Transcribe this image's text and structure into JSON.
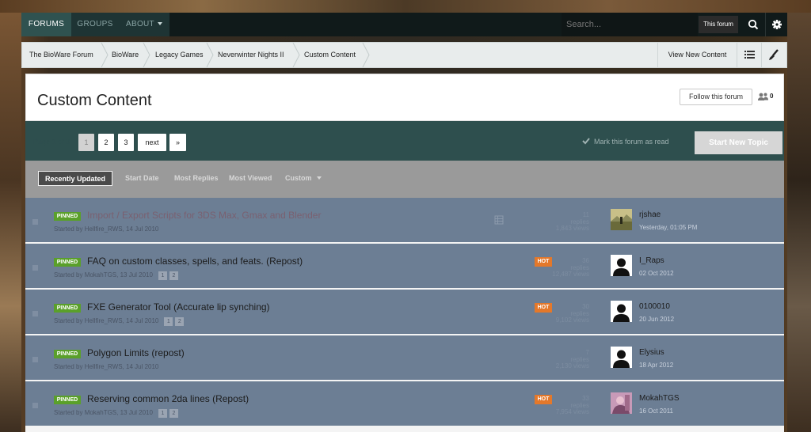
{
  "nav": {
    "tabs": [
      {
        "label": "FORUMS",
        "active": true
      },
      {
        "label": "GROUPS",
        "active": false
      },
      {
        "label": "ABOUT",
        "active": false
      }
    ],
    "search_placeholder": "Search...",
    "search_scope": "This forum",
    "icons": [
      "search-icon",
      "gear-icon"
    ]
  },
  "breadcrumb": {
    "items": [
      "The BioWare Forum",
      "BioWare",
      "Legacy Games",
      "Neverwinter Nights II",
      "Custom Content"
    ],
    "view_new": "View New Content",
    "icons": [
      "list-icon",
      "brush-icon"
    ]
  },
  "forum": {
    "title": "Custom Content",
    "follow_label": "Follow this forum",
    "follower_count": "0"
  },
  "pagination": {
    "label": "Page 1 of 3",
    "pages": [
      "1",
      "2",
      "3"
    ],
    "current": "1",
    "next_label": "next",
    "last_label": "»"
  },
  "actions": {
    "mark_read": "Mark this forum as read",
    "start_topic": "Start New Topic"
  },
  "sort": {
    "options": [
      "Recently Updated",
      "Start Date",
      "Most Replies",
      "Most Viewed",
      "Custom"
    ],
    "active": "Recently Updated"
  },
  "topics": [
    {
      "pinned": "PINNED",
      "title": "Import / Export Scripts for 3DS Max, Gmax and Blender",
      "meta": "Started by Hellfire_RWS, 14 Jul 2010",
      "pages": [],
      "hot": "",
      "stat1": "11 replies",
      "stat2": "1,843 views",
      "last_poster": "rjshae",
      "last_date": "Yesterday, 01:05 PM",
      "avatar": "landscape"
    },
    {
      "pinned": "PINNED",
      "title": "FAQ on custom classes, spells, and feats. (Repost)",
      "meta": "Started by MokahTGS, 13 Jul 2010",
      "pages": [
        "1",
        "2"
      ],
      "hot": "HOT",
      "stat1": "36 replies",
      "stat2": "12,487 views",
      "last_poster": "I_Raps",
      "last_date": "02 Oct 2012",
      "avatar": "silhouette"
    },
    {
      "pinned": "PINNED",
      "title": "FXE Generator Tool (Accurate lip synching)",
      "meta": "Started by Hellfire_RWS, 14 Jul 2010",
      "pages": [
        "1",
        "2"
      ],
      "hot": "HOT",
      "stat1": "30 replies",
      "stat2": "9,102 views",
      "last_poster": "0100010",
      "last_date": "20 Jun 2012",
      "avatar": "silhouette"
    },
    {
      "pinned": "PINNED",
      "title": "Polygon Limits (repost)",
      "meta": "Started by Hellfire_RWS, 14 Jul 2010",
      "pages": [],
      "hot": "",
      "stat1": "7 replies",
      "stat2": "2,130 views",
      "last_poster": "Elysius",
      "last_date": "18 Apr 2012",
      "avatar": "silhouette"
    },
    {
      "pinned": "PINNED",
      "title": "Reserving common 2da lines (Repost)",
      "meta": "Started by MokahTGS, 13 Jul 2010",
      "pages": [
        "1",
        "2"
      ],
      "hot": "HOT",
      "stat1": "33 replies",
      "stat2": "7,954 views",
      "last_poster": "MokahTGS",
      "last_date": "16 Oct 2011",
      "avatar": "portrait"
    }
  ],
  "colors": {
    "accent_teal": "#2e4f4e",
    "row_bg": "#6c7e94",
    "pinned_green": "#5aa02a",
    "hot_orange": "#e4782a"
  }
}
